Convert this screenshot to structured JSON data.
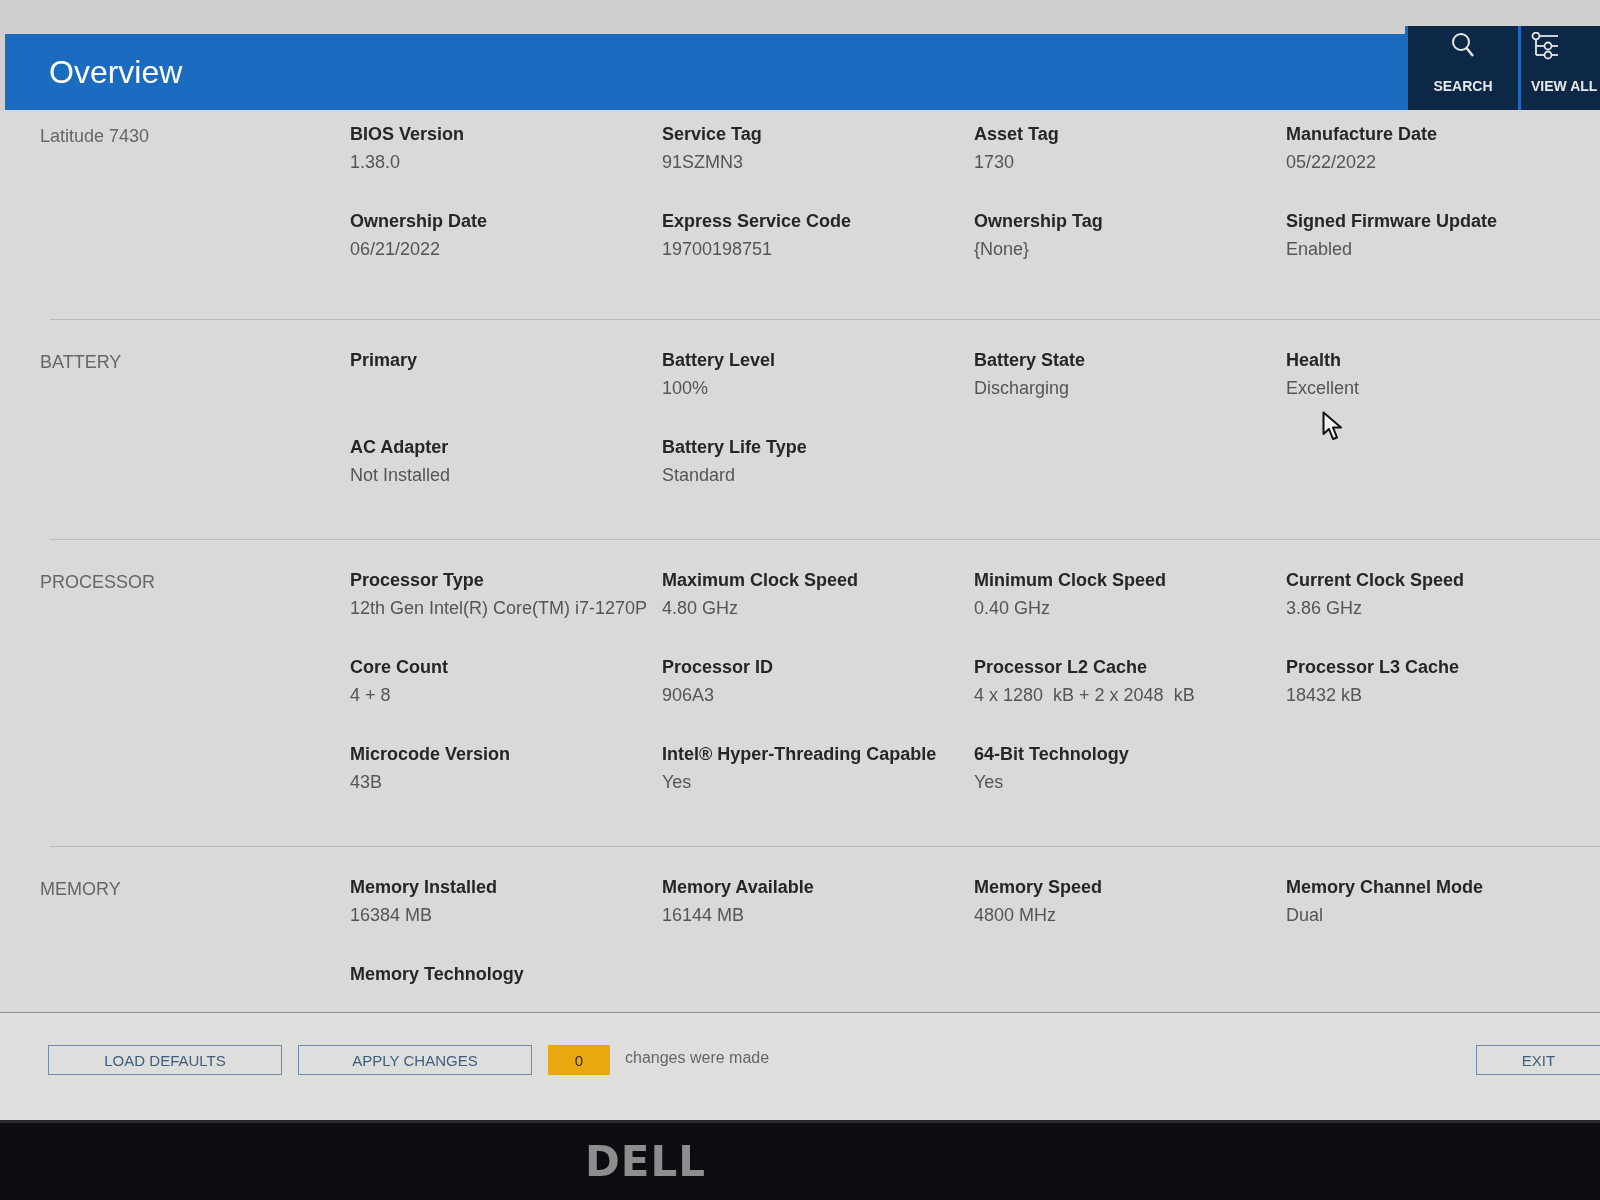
{
  "header": {
    "title": "Overview",
    "actions": [
      {
        "kind": "search",
        "label": "SEARCH"
      },
      {
        "kind": "view_all",
        "label": "VIEW ALL"
      }
    ]
  },
  "sections": [
    {
      "heading": "Latitude 7430",
      "fields": [
        {
          "label": "BIOS Version",
          "value": "1.38.0"
        },
        {
          "label": "Service Tag",
          "value": "91SZMN3"
        },
        {
          "label": "Asset Tag",
          "value": "1730"
        },
        {
          "label": "Manufacture Date",
          "value": "05/22/2022"
        },
        {
          "label": "Ownership Date",
          "value": "06/21/2022"
        },
        {
          "label": "Express Service Code",
          "value": "19700198751"
        },
        {
          "label": "Ownership Tag",
          "value": "{None}"
        },
        {
          "label": "Signed Firmware Update",
          "value": "Enabled"
        }
      ]
    },
    {
      "heading": "BATTERY",
      "fields": [
        {
          "label": "Primary"
        },
        {
          "label": "Battery Level",
          "value": "100%"
        },
        {
          "label": "Battery State",
          "value": "Discharging"
        },
        {
          "label": "Health",
          "value": "Excellent"
        },
        {
          "label": "AC Adapter",
          "value": "Not Installed"
        },
        {
          "label": "Battery Life Type",
          "value": "Standard"
        }
      ]
    },
    {
      "heading": "PROCESSOR",
      "fields": [
        {
          "label": "Processor Type",
          "value": "12th Gen Intel(R) Core(TM) i7-1270P"
        },
        {
          "label": "Maximum Clock Speed",
          "value": "4.80 GHz"
        },
        {
          "label": "Minimum Clock Speed",
          "value": "0.40 GHz"
        },
        {
          "label": "Current Clock Speed",
          "value": "3.86 GHz"
        },
        {
          "label": "Core Count",
          "value": "4 + 8"
        },
        {
          "label": "Processor ID",
          "value": "906A3"
        },
        {
          "label": "Processor L2 Cache",
          "value": "4 x 1280  kB + 2 x 2048  kB"
        },
        {
          "label": "Processor L3 Cache",
          "value": "18432 kB"
        },
        {
          "label": "Microcode Version",
          "value": "43B"
        },
        {
          "label": "Intel® Hyper-Threading Capable",
          "value": "Yes"
        },
        {
          "label": "64-Bit Technology",
          "value": "Yes"
        }
      ]
    },
    {
      "heading": "MEMORY",
      "fields": [
        {
          "label": "Memory Installed",
          "value": "16384 MB"
        },
        {
          "label": "Memory Available",
          "value": "16144 MB"
        },
        {
          "label": "Memory Speed",
          "value": "4800 MHz"
        },
        {
          "label": "Memory Channel Mode",
          "value": "Dual"
        },
        {
          "label": "Memory Technology"
        }
      ]
    }
  ],
  "footer": {
    "buttons": [
      "LOAD DEFAULTS",
      "APPLY CHANGES"
    ],
    "changes_count": "0",
    "changes_text": "changes were made",
    "exit_button": "EXIT"
  },
  "bezel": {
    "logo": "DELL"
  }
}
